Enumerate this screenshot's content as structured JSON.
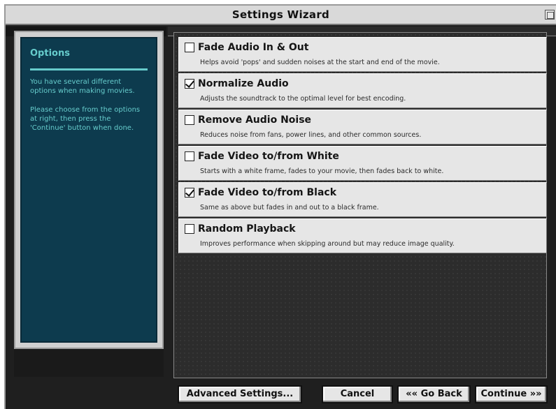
{
  "window": {
    "title": "Settings Wizard"
  },
  "sidebar": {
    "title": "Options",
    "paragraph1": "You have several different options when making movies.",
    "paragraph2": "Please choose from the options at right, then press the 'Continue' button when done."
  },
  "options": [
    {
      "label": "Fade Audio In & Out",
      "description": "Helps avoid 'pops' and sudden noises at the start and end of the movie.",
      "checked": false
    },
    {
      "label": "Normalize Audio",
      "description": "Adjusts the soundtrack to the optimal level for best encoding.",
      "checked": true
    },
    {
      "label": "Remove Audio Noise",
      "description": "Reduces noise from fans, power lines, and other common sources.",
      "checked": false
    },
    {
      "label": "Fade Video to/from White",
      "description": "Starts with a white frame, fades to your movie, then fades back to white.",
      "checked": false
    },
    {
      "label": "Fade Video to/from Black",
      "description": "Same as above but fades in and out to a black frame.",
      "checked": true
    },
    {
      "label": "Random Playback",
      "description": "Improves performance when skipping around but may reduce image quality.",
      "checked": false
    }
  ],
  "buttons": {
    "advanced": "Advanced Settings...",
    "cancel": "Cancel",
    "back": "«« Go Back",
    "continue": "Continue »»"
  }
}
